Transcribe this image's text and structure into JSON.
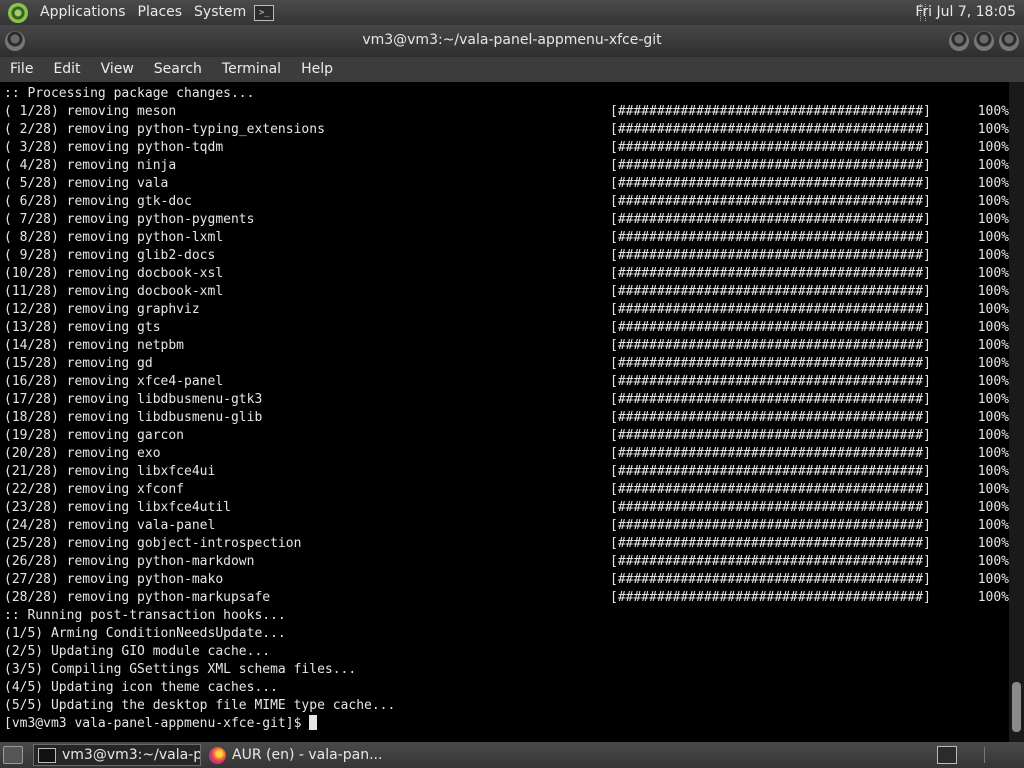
{
  "top_panel": {
    "menus": [
      "Applications",
      "Places",
      "System"
    ],
    "launcher_icon": "terminal-icon",
    "clock": "Fri Jul  7, 18:05"
  },
  "window": {
    "title": "vm3@vm3:~/vala-panel-appmenu-xfce-git",
    "buttons": [
      "minimize",
      "maximize",
      "close"
    ]
  },
  "menubar": {
    "items": [
      "File",
      "Edit",
      "View",
      "Search",
      "Terminal",
      "Help"
    ]
  },
  "terminal": {
    "lines": [
      {
        "text": ":: Processing package changes..."
      },
      {
        "text": "( 1/28) removing meson",
        "bar": "[#######################################]",
        "pct": "100%"
      },
      {
        "text": "( 2/28) removing python-typing_extensions",
        "bar": "[#######################################]",
        "pct": "100%"
      },
      {
        "text": "( 3/28) removing python-tqdm",
        "bar": "[#######################################]",
        "pct": "100%"
      },
      {
        "text": "( 4/28) removing ninja",
        "bar": "[#######################################]",
        "pct": "100%"
      },
      {
        "text": "( 5/28) removing vala",
        "bar": "[#######################################]",
        "pct": "100%"
      },
      {
        "text": "( 6/28) removing gtk-doc",
        "bar": "[#######################################]",
        "pct": "100%"
      },
      {
        "text": "( 7/28) removing python-pygments",
        "bar": "[#######################################]",
        "pct": "100%"
      },
      {
        "text": "( 8/28) removing python-lxml",
        "bar": "[#######################################]",
        "pct": "100%"
      },
      {
        "text": "( 9/28) removing glib2-docs",
        "bar": "[#######################################]",
        "pct": "100%"
      },
      {
        "text": "(10/28) removing docbook-xsl",
        "bar": "[#######################################]",
        "pct": "100%"
      },
      {
        "text": "(11/28) removing docbook-xml",
        "bar": "[#######################################]",
        "pct": "100%"
      },
      {
        "text": "(12/28) removing graphviz",
        "bar": "[#######################################]",
        "pct": "100%"
      },
      {
        "text": "(13/28) removing gts",
        "bar": "[#######################################]",
        "pct": "100%"
      },
      {
        "text": "(14/28) removing netpbm",
        "bar": "[#######################################]",
        "pct": "100%"
      },
      {
        "text": "(15/28) removing gd",
        "bar": "[#######################################]",
        "pct": "100%"
      },
      {
        "text": "(16/28) removing xfce4-panel",
        "bar": "[#######################################]",
        "pct": "100%"
      },
      {
        "text": "(17/28) removing libdbusmenu-gtk3",
        "bar": "[#######################################]",
        "pct": "100%"
      },
      {
        "text": "(18/28) removing libdbusmenu-glib",
        "bar": "[#######################################]",
        "pct": "100%"
      },
      {
        "text": "(19/28) removing garcon",
        "bar": "[#######################################]",
        "pct": "100%"
      },
      {
        "text": "(20/28) removing exo",
        "bar": "[#######################################]",
        "pct": "100%"
      },
      {
        "text": "(21/28) removing libxfce4ui",
        "bar": "[#######################################]",
        "pct": "100%"
      },
      {
        "text": "(22/28) removing xfconf",
        "bar": "[#######################################]",
        "pct": "100%"
      },
      {
        "text": "(23/28) removing libxfce4util",
        "bar": "[#######################################]",
        "pct": "100%"
      },
      {
        "text": "(24/28) removing vala-panel",
        "bar": "[#######################################]",
        "pct": "100%"
      },
      {
        "text": "(25/28) removing gobject-introspection",
        "bar": "[#######################################]",
        "pct": "100%"
      },
      {
        "text": "(26/28) removing python-markdown",
        "bar": "[#######################################]",
        "pct": "100%"
      },
      {
        "text": "(27/28) removing python-mako",
        "bar": "[#######################################]",
        "pct": "100%"
      },
      {
        "text": "(28/28) removing python-markupsafe",
        "bar": "[#######################################]",
        "pct": "100%"
      },
      {
        "text": ":: Running post-transaction hooks..."
      },
      {
        "text": "(1/5) Arming ConditionNeedsUpdate..."
      },
      {
        "text": "(2/5) Updating GIO module cache..."
      },
      {
        "text": "(3/5) Compiling GSettings XML schema files..."
      },
      {
        "text": "(4/5) Updating icon theme caches..."
      },
      {
        "text": "(5/5) Updating the desktop file MIME type cache..."
      }
    ],
    "prompt": "[vm3@vm3 vala-panel-appmenu-xfce-git]$ "
  },
  "taskbar": {
    "tasks": [
      {
        "label": "vm3@vm3:~/vala-p...",
        "icon": "terminal-icon",
        "active": true
      },
      {
        "label": "AUR (en) - vala-pan...",
        "icon": "firefox-icon",
        "active": false
      }
    ],
    "tray_icon": "terminal-icon"
  },
  "colors": {
    "terminal_bg": "#000000",
    "terminal_fg": "#e6e6e6",
    "panel_bg": "#3c3c3c"
  }
}
